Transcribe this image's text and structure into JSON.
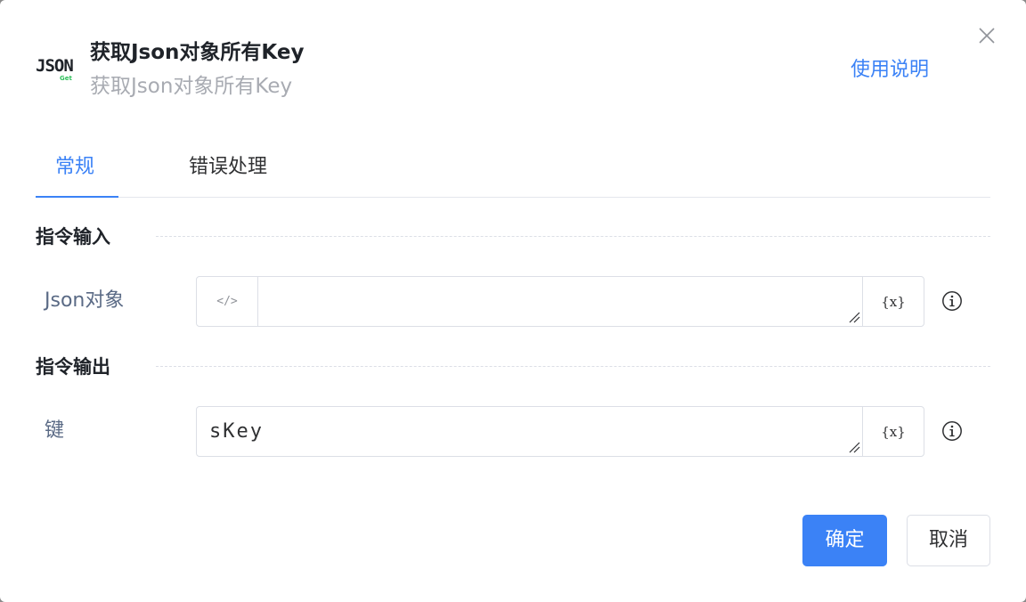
{
  "dialog": {
    "logo": {
      "text": "JSON",
      "badge": "Get"
    },
    "title": "获取Json对象所有Key",
    "subtitle": "获取Json对象所有Key",
    "help_link": "使用说明",
    "close_icon": "close-icon"
  },
  "tabs": [
    {
      "label": "常规",
      "active": true
    },
    {
      "label": "错误处理",
      "active": false
    }
  ],
  "sections": {
    "input": {
      "title": "指令输入",
      "fields": [
        {
          "label": "Json对象",
          "prefix": "</>",
          "value": "",
          "var_button": "{x}"
        }
      ]
    },
    "output": {
      "title": "指令输出",
      "fields": [
        {
          "label": "键",
          "value": "sKey",
          "var_button": "{x}"
        }
      ]
    }
  },
  "footer": {
    "ok_label": "确定",
    "cancel_label": "取消"
  },
  "colors": {
    "accent": "#3b82f6",
    "logo_badge": "#2fbf5b"
  }
}
